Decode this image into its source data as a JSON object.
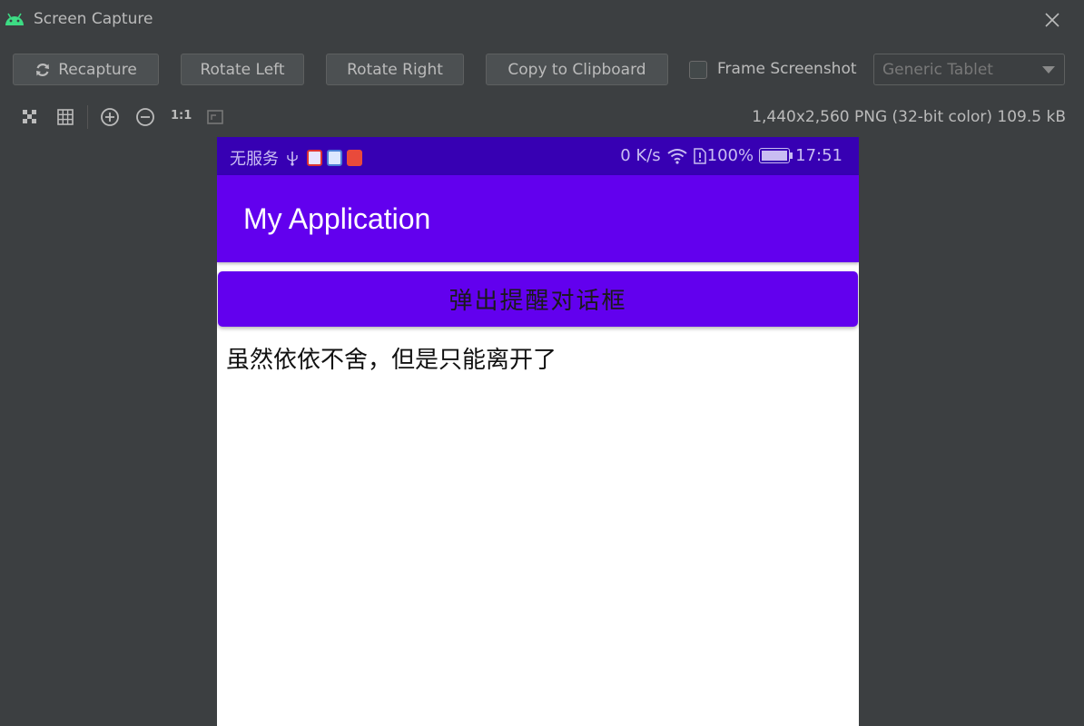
{
  "window": {
    "title": "Screen Capture"
  },
  "toolbar": {
    "recapture": "Recapture",
    "rotate_left": "Rotate Left",
    "rotate_right": "Rotate Right",
    "copy": "Copy to Clipboard",
    "frame_label": "Frame Screenshot",
    "frame_checked": false,
    "device": "Generic Tablet"
  },
  "iconbar": {
    "one_to_one": "1:1",
    "info": "1,440x2,560 PNG (32-bit color) 109.5 kB"
  },
  "device": {
    "status": {
      "carrier": "无服务",
      "speed": "0 K/s",
      "battery": "100%",
      "time": "17:51"
    },
    "appbar_title": "My Application",
    "button_label": "弹出提醒对话框",
    "message": "虽然依依不舍，但是只能离开了"
  },
  "colors": {
    "ide_bg": "#3c3f41",
    "status_bar": "#3700b3",
    "primary": "#6200ee"
  }
}
